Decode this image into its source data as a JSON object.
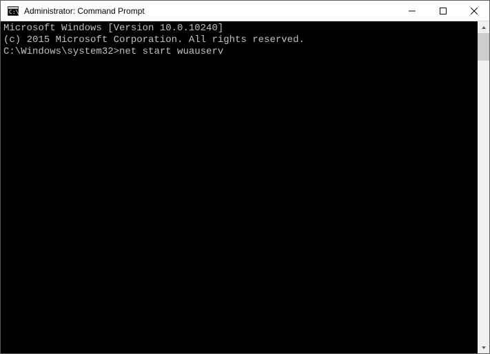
{
  "window": {
    "title": "Administrator: Command Prompt"
  },
  "terminal": {
    "line1": "Microsoft Windows [Version 10.0.10240]",
    "line2": "(c) 2015 Microsoft Corporation. All rights reserved.",
    "blank": "",
    "prompt": "C:\\Windows\\system32>",
    "command": "net start wuauserv"
  }
}
